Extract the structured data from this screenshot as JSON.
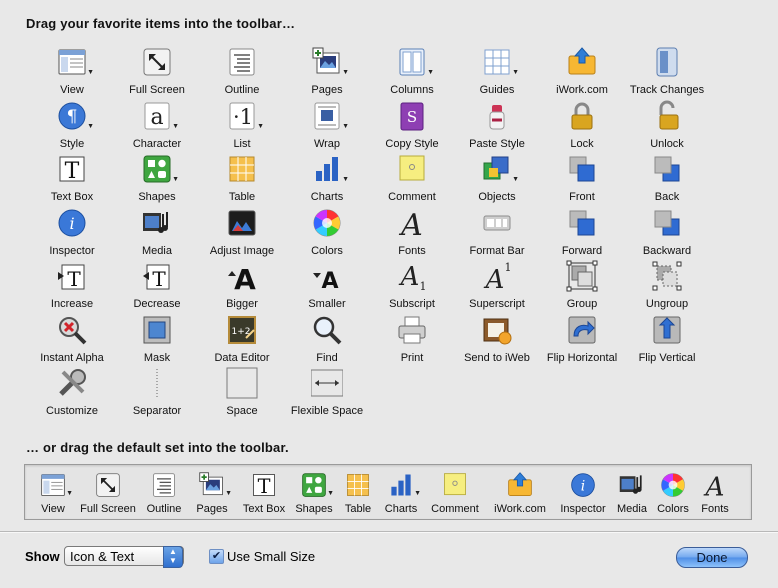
{
  "header": {
    "title": "Drag your favorite items into the toolbar…"
  },
  "palette": [
    {
      "label": "View",
      "icon": "view-icon",
      "has_menu": true
    },
    {
      "label": "Full Screen",
      "icon": "full-screen-icon",
      "has_menu": false
    },
    {
      "label": "Outline",
      "icon": "outline-icon",
      "has_menu": false
    },
    {
      "label": "Pages",
      "icon": "pages-icon",
      "has_menu": true
    },
    {
      "label": "Columns",
      "icon": "columns-icon",
      "has_menu": true
    },
    {
      "label": "Guides",
      "icon": "guides-icon",
      "has_menu": true
    },
    {
      "label": "iWork.com",
      "icon": "iwork-com-icon",
      "has_menu": false
    },
    {
      "label": "Track Changes",
      "icon": "track-changes-icon",
      "has_menu": false
    },
    {
      "label": "Style",
      "icon": "style-icon",
      "has_menu": true
    },
    {
      "label": "Character",
      "icon": "character-icon",
      "has_menu": true
    },
    {
      "label": "List",
      "icon": "list-icon",
      "has_menu": true
    },
    {
      "label": "Wrap",
      "icon": "wrap-icon",
      "has_menu": true
    },
    {
      "label": "Copy Style",
      "icon": "copy-style-icon",
      "has_menu": false
    },
    {
      "label": "Paste Style",
      "icon": "paste-style-icon",
      "has_menu": false
    },
    {
      "label": "Lock",
      "icon": "lock-icon",
      "has_menu": false
    },
    {
      "label": "Unlock",
      "icon": "unlock-icon",
      "has_menu": false
    },
    {
      "label": "Text Box",
      "icon": "text-box-icon",
      "has_menu": false
    },
    {
      "label": "Shapes",
      "icon": "shapes-icon",
      "has_menu": true
    },
    {
      "label": "Table",
      "icon": "table-icon",
      "has_menu": false
    },
    {
      "label": "Charts",
      "icon": "charts-icon",
      "has_menu": true
    },
    {
      "label": "Comment",
      "icon": "comment-icon",
      "has_menu": false
    },
    {
      "label": "Objects",
      "icon": "objects-icon",
      "has_menu": true
    },
    {
      "label": "Front",
      "icon": "front-icon",
      "has_menu": false
    },
    {
      "label": "Back",
      "icon": "back-icon",
      "has_menu": false
    },
    {
      "label": "Inspector",
      "icon": "inspector-icon",
      "has_menu": false
    },
    {
      "label": "Media",
      "icon": "media-icon",
      "has_menu": false
    },
    {
      "label": "Adjust Image",
      "icon": "adjust-image-icon",
      "has_menu": false
    },
    {
      "label": "Colors",
      "icon": "colors-icon",
      "has_menu": false
    },
    {
      "label": "Fonts",
      "icon": "fonts-icon",
      "has_menu": false
    },
    {
      "label": "Format Bar",
      "icon": "format-bar-icon",
      "has_menu": false
    },
    {
      "label": "Forward",
      "icon": "forward-icon",
      "has_menu": false
    },
    {
      "label": "Backward",
      "icon": "backward-icon",
      "has_menu": false
    },
    {
      "label": "Increase",
      "icon": "increase-icon",
      "has_menu": false
    },
    {
      "label": "Decrease",
      "icon": "decrease-icon",
      "has_menu": false
    },
    {
      "label": "Bigger",
      "icon": "bigger-icon",
      "has_menu": false
    },
    {
      "label": "Smaller",
      "icon": "smaller-icon",
      "has_menu": false
    },
    {
      "label": "Subscript",
      "icon": "subscript-icon",
      "has_menu": false
    },
    {
      "label": "Superscript",
      "icon": "superscript-icon",
      "has_menu": false
    },
    {
      "label": "Group",
      "icon": "group-icon",
      "has_menu": false
    },
    {
      "label": "Ungroup",
      "icon": "ungroup-icon",
      "has_menu": false
    },
    {
      "label": "Instant Alpha",
      "icon": "instant-alpha-icon",
      "has_menu": false
    },
    {
      "label": "Mask",
      "icon": "mask-icon",
      "has_menu": false
    },
    {
      "label": "Data Editor",
      "icon": "data-editor-icon",
      "has_menu": false
    },
    {
      "label": "Find",
      "icon": "find-icon",
      "has_menu": false
    },
    {
      "label": "Print",
      "icon": "print-icon",
      "has_menu": false
    },
    {
      "label": "Send to iWeb",
      "icon": "send-to-iweb-icon",
      "has_menu": false
    },
    {
      "label": "Flip Horizontal",
      "icon": "flip-horizontal-icon",
      "has_menu": false
    },
    {
      "label": "Flip Vertical",
      "icon": "flip-vertical-icon",
      "has_menu": false
    },
    {
      "label": "Customize",
      "icon": "customize-icon",
      "has_menu": false
    },
    {
      "label": "Separator",
      "icon": "separator-icon",
      "has_menu": false
    },
    {
      "label": "Space",
      "icon": "space-icon",
      "has_menu": false
    },
    {
      "label": "Flexible Space",
      "icon": "flexible-space-icon",
      "has_menu": false
    }
  ],
  "default_section": {
    "title": "… or drag the default set into the toolbar."
  },
  "default_set": [
    {
      "label": "View",
      "icon": "view-icon",
      "has_menu": true
    },
    {
      "label": "Full Screen",
      "icon": "full-screen-icon",
      "has_menu": false
    },
    {
      "label": "Outline",
      "icon": "outline-icon",
      "has_menu": false
    },
    {
      "label": "Pages",
      "icon": "pages-icon",
      "has_menu": true
    },
    {
      "label": "Text Box",
      "icon": "text-box-icon",
      "has_menu": false
    },
    {
      "label": "Shapes",
      "icon": "shapes-icon",
      "has_menu": true
    },
    {
      "label": "Table",
      "icon": "table-icon",
      "has_menu": false
    },
    {
      "label": "Charts",
      "icon": "charts-icon",
      "has_menu": true
    },
    {
      "label": "Comment",
      "icon": "comment-icon",
      "has_menu": false
    },
    {
      "label": "iWork.com",
      "icon": "iwork-com-icon",
      "has_menu": false
    },
    {
      "label": "Inspector",
      "icon": "inspector-icon",
      "has_menu": false
    },
    {
      "label": "Media",
      "icon": "media-icon",
      "has_menu": false
    },
    {
      "label": "Colors",
      "icon": "colors-icon",
      "has_menu": false
    },
    {
      "label": "Fonts",
      "icon": "fonts-icon",
      "has_menu": false
    }
  ],
  "footer": {
    "show_label": "Show",
    "show_value": "Icon & Text",
    "small_size_label": "Use Small Size",
    "small_size_checked": true,
    "done_label": "Done"
  }
}
